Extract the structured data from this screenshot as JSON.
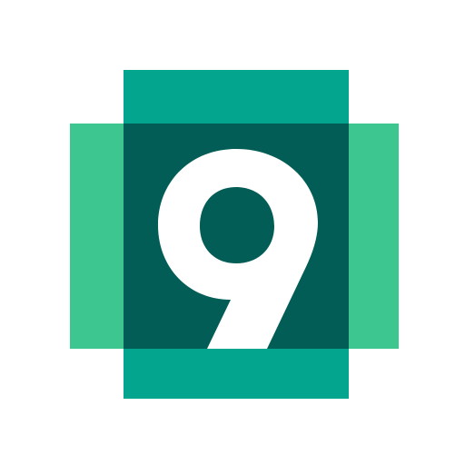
{
  "logo": {
    "glyph": "9",
    "colors": {
      "background": "#ffffff",
      "side_bars": "#3ec690",
      "top_bottom_bar": "#03a58e",
      "center_square": "#025d56",
      "glyph": "#ffffff"
    }
  }
}
